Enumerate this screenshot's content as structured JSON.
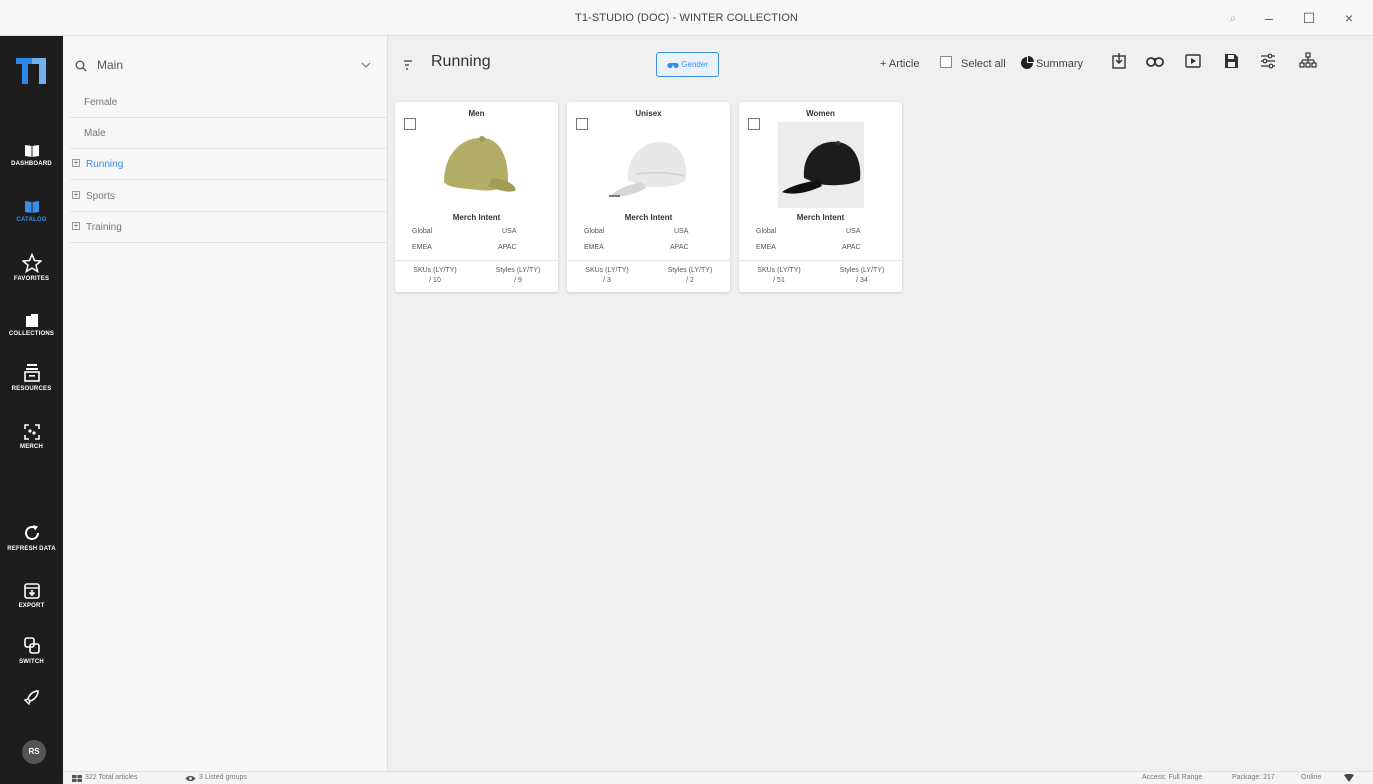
{
  "window": {
    "title": "T1-STUDIO (DOC) - WINTER COLLECTION"
  },
  "nav": {
    "items": [
      {
        "label": "DASHBOARD"
      },
      {
        "label": "CATALOG"
      },
      {
        "label": "FAVORITES"
      },
      {
        "label": "COLLECTIONS"
      },
      {
        "label": "RESOURCES"
      },
      {
        "label": "MERCH"
      },
      {
        "label": "REFRESH DATA"
      },
      {
        "label": "EXPORT"
      },
      {
        "label": "SWITCH"
      }
    ],
    "avatar": "RS",
    "accent": "#3b8ee6"
  },
  "tree": {
    "search_value": "Main",
    "rows": [
      {
        "label": "Female"
      },
      {
        "label": "Male"
      },
      {
        "label": "Running"
      },
      {
        "label": "Sports"
      },
      {
        "label": "Training"
      }
    ]
  },
  "toolbar": {
    "heading": "Running",
    "gender_button": "Gender",
    "add_article": "+ Article",
    "select_all": "Select all",
    "summary": "Summary"
  },
  "cards": [
    {
      "name": "Men",
      "merch_intent": "Merch Intent",
      "regions": [
        "Global",
        "USA",
        "EMEA",
        "APAC"
      ],
      "skus_label": "SKUs (LY/TY)",
      "skus_value": "/ 10",
      "styles_label": "Styles (LY/TY)",
      "styles_value": "/ 9",
      "cap_color": "#b4ad68"
    },
    {
      "name": "Unisex",
      "merch_intent": "Merch Intent",
      "regions": [
        "Global",
        "USA",
        "EMEA",
        "APAC"
      ],
      "skus_label": "SKUs (LY/TY)",
      "skus_value": "/ 3",
      "styles_label": "Styles (LY/TY)",
      "styles_value": "/ 2",
      "cap_color": "#e6e6e6"
    },
    {
      "name": "Women",
      "merch_intent": "Merch Intent",
      "regions": [
        "Global",
        "USA",
        "EMEA",
        "APAC"
      ],
      "skus_label": "SKUs (LY/TY)",
      "skus_value": "/ 51",
      "styles_label": "Styles (LY/TY)",
      "styles_value": "/ 34",
      "cap_color": "#1c1c1c"
    }
  ],
  "status": {
    "total_articles": "322 Total articles",
    "listed_groups": "3 Listed groups",
    "access": "Access: Full Range",
    "package": "Package: 217",
    "online": "Online"
  }
}
